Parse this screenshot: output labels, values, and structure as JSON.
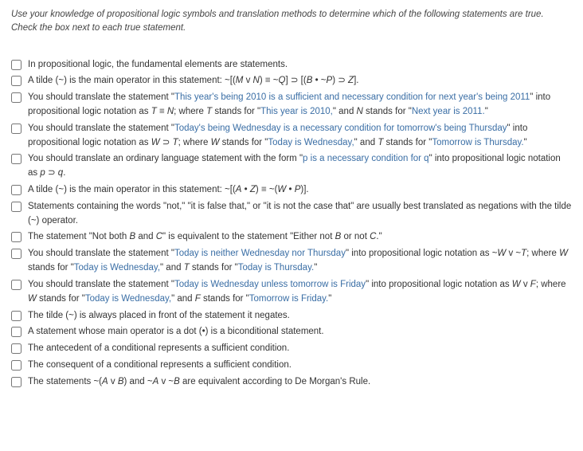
{
  "instructions": "Use your knowledge of propositional logic symbols and translation methods to determine which of the following statements are true. Check the box next to each true statement.",
  "items": [
    {
      "plain": "In propositional logic, the fundamental elements are statements."
    },
    {
      "pre": "A tilde (~) is the main operator in this statement: ~[(",
      "v1": "M",
      "mid1": " v ",
      "v2": "N",
      "mid2": ") ≡ ~",
      "v3": "Q",
      "mid3": "] ⊃ [(",
      "v4": "B",
      "mid4": " • ~",
      "v5": "P",
      "mid5": ") ⊃ ",
      "v6": "Z",
      "post": "]."
    },
    {
      "pre": "You should translate the statement \"",
      "hl1": "This year's being 2010 is a sufficient and necessary condition for next year's being 2011",
      "mid1": "\" into propositional logic notation as ",
      "v1": "T",
      "mid2": " ≡ ",
      "v2": "N",
      "mid3": "; where ",
      "v3": "T",
      "mid4": " stands for \"",
      "hl2": "This year is 2010,",
      "mid5": "\" and ",
      "v4": "N",
      "mid6": " stands for \"",
      "hl3": "Next year is 2011.",
      "post": "\""
    },
    {
      "pre": "You should translate the statement \"",
      "hl1": "Today's being Wednesday is a necessary condition for tomorrow's being Thursday",
      "mid1": "\" into propositional logic notation as ",
      "v1": "W",
      "mid2": " ⊃ ",
      "v2": "T",
      "mid3": "; where ",
      "v3": "W",
      "mid4": " stands for \"",
      "hl2": "Today is Wednesday,",
      "mid5": "\" and ",
      "v4": "T",
      "mid6": " stands for \"",
      "hl3": "Tomorrow is Thursday.",
      "post": "\""
    },
    {
      "pre": "You should translate an ordinary language statement with the form \"",
      "hl1": "p is a necessary condition for q",
      "mid1": "\" into propositional logic notation as ",
      "v1": "p",
      "mid2": " ⊃ ",
      "v2": "q",
      "post": "."
    },
    {
      "pre": "A tilde (~) is the main operator in this statement: ~[(",
      "v1": "A",
      "mid1": " • ",
      "v2": "Z",
      "mid2": ") ≡ ~(",
      "v3": "W",
      "mid3": " • ",
      "v4": "P",
      "post": ")]."
    },
    {
      "plain": "Statements containing the words \"not,\" \"it is false that,\" or \"it is not the case that\" are usually best translated as negations with the tilde (~) operator."
    },
    {
      "pre": "The statement \"Not both ",
      "v1": "B",
      "mid1": " and ",
      "v2": "C",
      "mid2": "\" is equivalent to the statement \"Either not ",
      "v3": "B",
      "mid3": " or not ",
      "v4": "C",
      "post": ".\""
    },
    {
      "pre": "You should translate the statement \"",
      "hl1": "Today is neither Wednesday nor Thursday",
      "mid1": "\" into propositional logic notation as ~",
      "v1": "W",
      "mid2": " v ~",
      "v2": "T",
      "mid3": "; where ",
      "v3": "W",
      "mid4": " stands for \"",
      "hl2": "Today is Wednesday,",
      "mid5": "\" and ",
      "v4": "T",
      "mid6": " stands for \"",
      "hl3": "Today is Thursday.",
      "post": "\""
    },
    {
      "pre": "You should translate the statement \"",
      "hl1": "Today is Wednesday unless tomorrow is Friday",
      "mid1": "\" into propositional logic notation as ",
      "v1": "W",
      "mid2": " v ",
      "v2": "F",
      "mid3": "; where ",
      "v3": "W",
      "mid4": " stands for \"",
      "hl2": "Today is Wednesday,",
      "mid5": "\" and ",
      "v4": "F",
      "mid6": " stands for \"",
      "hl3": "Tomorrow is Friday.",
      "post": "\""
    },
    {
      "plain": "The tilde (~) is always placed in front of the statement it negates."
    },
    {
      "plain": "A statement whose main operator is a dot (•) is a biconditional statement."
    },
    {
      "plain": "The antecedent of a conditional represents a sufficient condition."
    },
    {
      "plain": "The consequent of a conditional represents a sufficient condition."
    },
    {
      "pre": "The statements ~(",
      "v1": "A",
      "mid1": " v ",
      "v2": "B",
      "mid2": ") and ~",
      "v3": "A",
      "mid3": " v ~",
      "v4": "B",
      "post": " are equivalent according to De Morgan's Rule."
    }
  ]
}
